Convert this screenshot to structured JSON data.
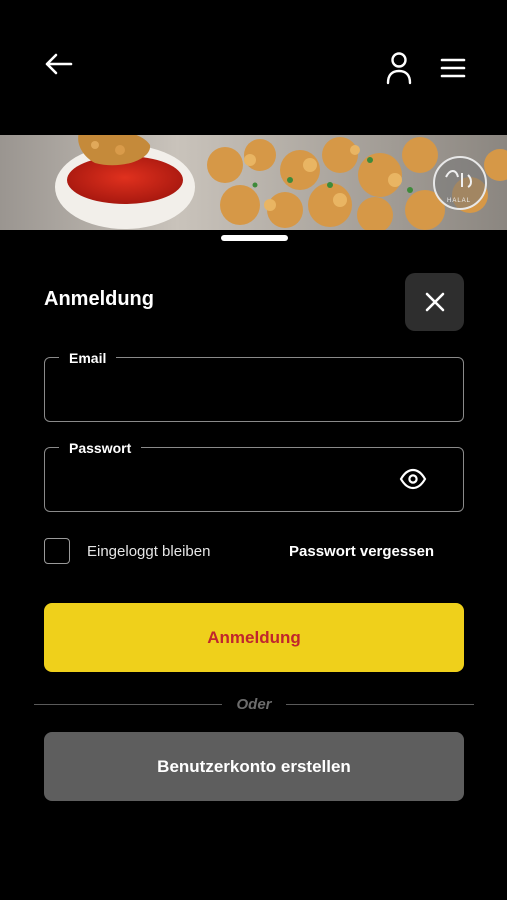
{
  "header": {
    "back_icon": "arrow-left-icon",
    "user_icon": "user-icon",
    "menu_icon": "hamburger-menu-icon"
  },
  "hero": {
    "badge_text": "HALAL"
  },
  "login": {
    "title": "Anmeldung",
    "close_icon": "close-icon",
    "email_label": "Email",
    "email_value": "",
    "password_label": "Passwort",
    "password_value": "",
    "show_password_icon": "eye-icon",
    "remember_label": "Eingeloggt bleiben",
    "remember_checked": false,
    "forgot_label": "Passwort vergessen",
    "submit_label": "Anmeldung",
    "divider_label": "Oder",
    "register_label": "Benutzerkonto erstellen"
  },
  "colors": {
    "primary_button": "#efd01b",
    "primary_text": "#c0262d",
    "secondary_button": "#5e5e5e",
    "background": "#000000"
  }
}
